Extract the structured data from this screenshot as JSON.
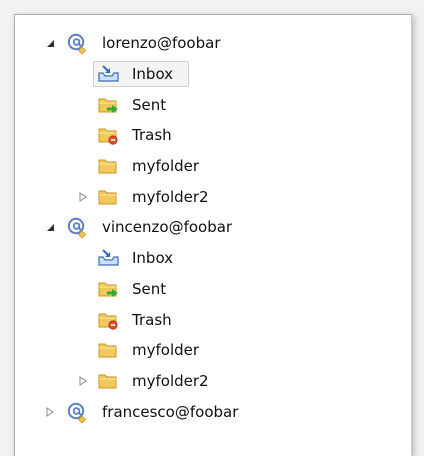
{
  "accounts": [
    {
      "name": "lorenzo@foobar",
      "expanded": true,
      "folders": [
        {
          "label": "Inbox",
          "icon": "inbox-icon",
          "selected": true
        },
        {
          "label": "Sent",
          "icon": "sent-folder-icon"
        },
        {
          "label": "Trash",
          "icon": "trash-folder-icon"
        },
        {
          "label": "myfolder",
          "icon": "folder-icon"
        },
        {
          "label": "myfolder2",
          "icon": "folder-icon",
          "collapsed": true
        }
      ]
    },
    {
      "name": "vincenzo@foobar",
      "expanded": true,
      "folders": [
        {
          "label": "Inbox",
          "icon": "inbox-icon"
        },
        {
          "label": "Sent",
          "icon": "sent-folder-icon"
        },
        {
          "label": "Trash",
          "icon": "trash-folder-icon"
        },
        {
          "label": "myfolder",
          "icon": "folder-icon"
        },
        {
          "label": "myfolder2",
          "icon": "folder-icon",
          "collapsed": true
        }
      ]
    },
    {
      "name": "francesco@foobar",
      "expanded": false,
      "folders": []
    }
  ],
  "colors": {
    "folder_yellow": "#f3c95b",
    "at_blue": "#5a7fc7",
    "sent_arrow_green": "#3aa639",
    "trash_red": "#e04a2a"
  }
}
